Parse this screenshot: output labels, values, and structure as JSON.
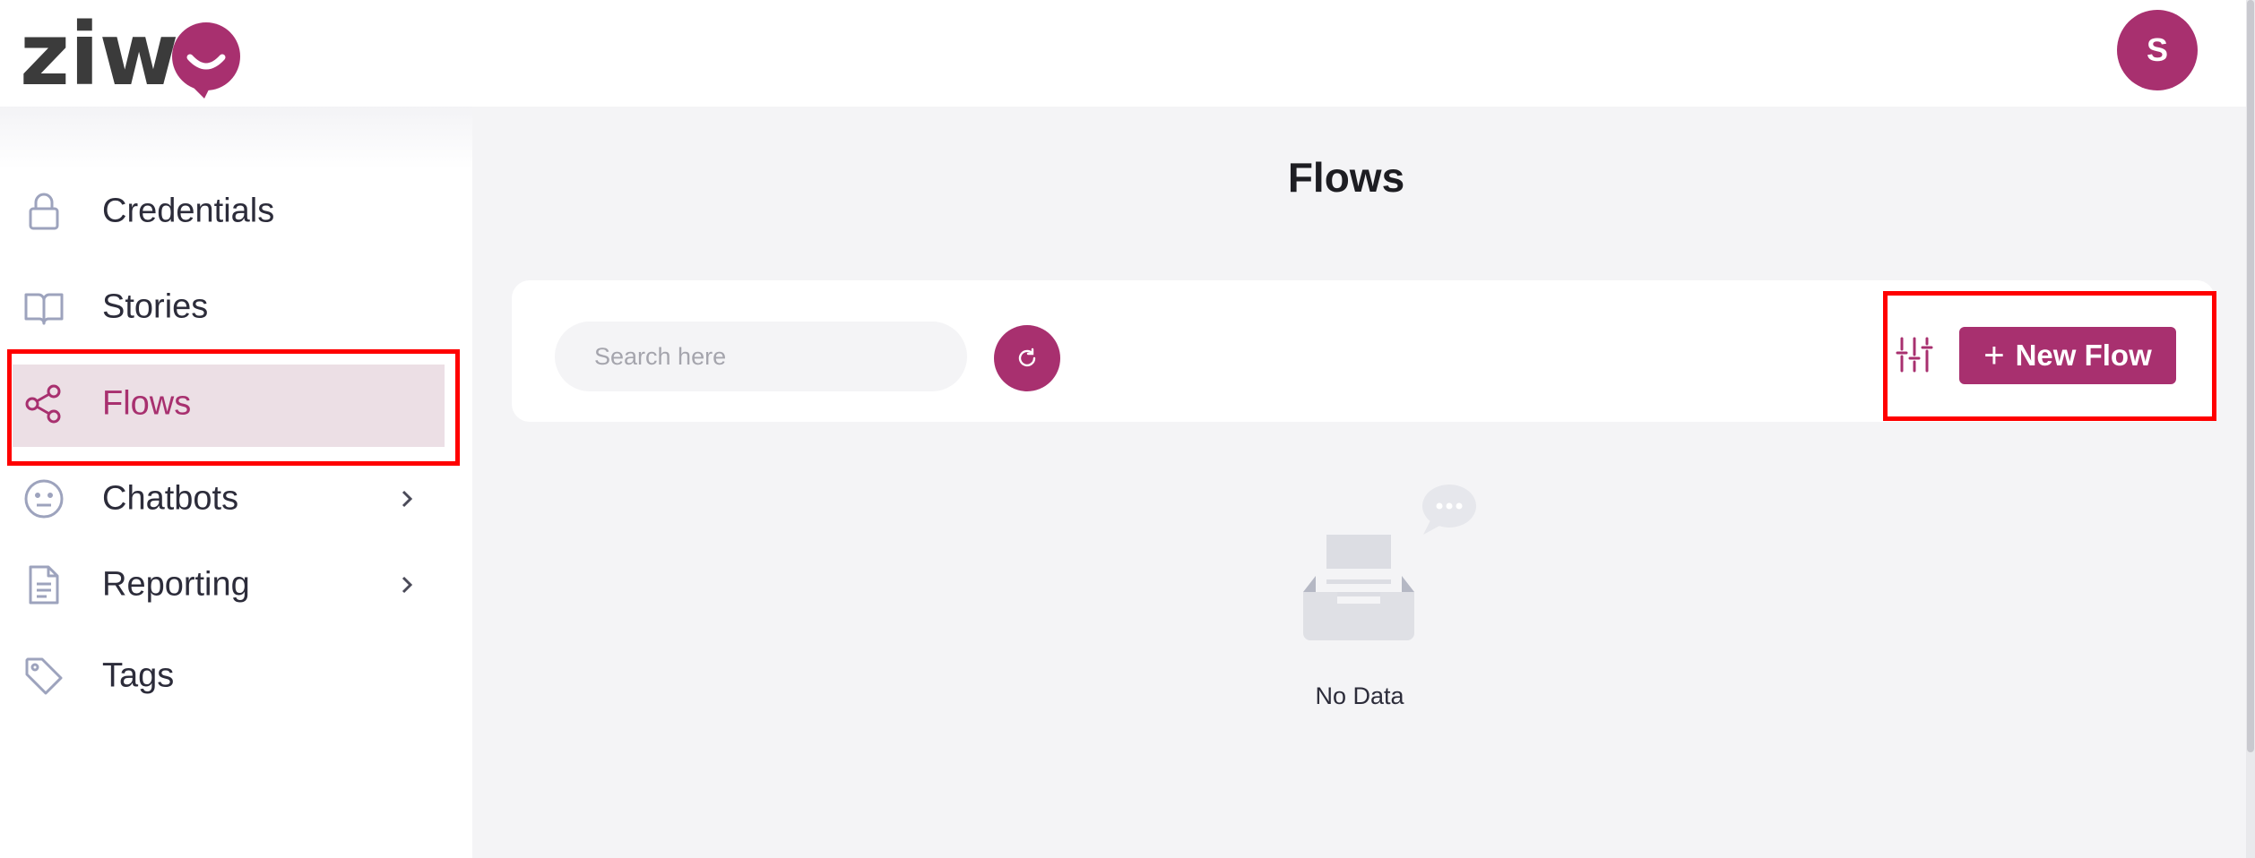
{
  "header": {
    "logo_text": "ziw",
    "avatar_initial": "S"
  },
  "sidebar": {
    "items": [
      {
        "label": "Credentials",
        "icon": "lock-icon"
      },
      {
        "label": "Stories",
        "icon": "book-open-icon"
      },
      {
        "label": "Flows",
        "icon": "share-nodes-icon",
        "active": true
      },
      {
        "label": "Chatbots",
        "icon": "face-neutral-icon",
        "has_submenu": true
      },
      {
        "label": "Reporting",
        "icon": "document-icon",
        "has_submenu": true
      },
      {
        "label": "Tags",
        "icon": "tag-icon"
      }
    ]
  },
  "main": {
    "title": "Flows",
    "search": {
      "placeholder": "Search here",
      "value": ""
    },
    "new_flow_label": "New Flow",
    "empty_text": "No Data"
  },
  "colors": {
    "accent": "#a8306f",
    "active_bg": "#ecdfe5",
    "highlight": "#ff0000",
    "icon": "#9da3bd"
  }
}
